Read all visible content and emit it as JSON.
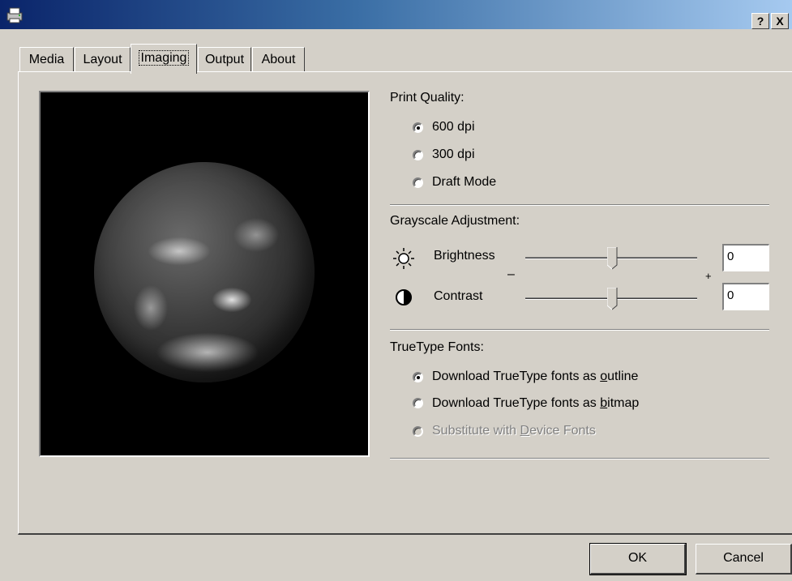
{
  "window": {
    "title": "",
    "help_button": "?",
    "close_button": "X"
  },
  "tabs": [
    {
      "label": "Media"
    },
    {
      "label": "Layout"
    },
    {
      "label": "Imaging"
    },
    {
      "label": "Output"
    },
    {
      "label": "About"
    }
  ],
  "active_tab": "Imaging",
  "print_quality": {
    "label": "Print Quality:",
    "options": [
      {
        "label": "600 dpi",
        "checked": true
      },
      {
        "label": "300 dpi",
        "checked": false
      },
      {
        "label": "Draft Mode",
        "checked": false
      }
    ]
  },
  "grayscale": {
    "label": "Grayscale Adjustment:",
    "minus": "–",
    "plus": "+",
    "brightness": {
      "label": "Brightness",
      "value": "0",
      "icon": "sun-icon"
    },
    "contrast": {
      "label": "Contrast",
      "value": "0",
      "icon": "contrast-icon"
    }
  },
  "truetype": {
    "label": "TrueType Fonts:",
    "options": [
      {
        "pre": "Download TrueType fonts as ",
        "accel": "o",
        "post": "utline",
        "checked": true,
        "disabled": false
      },
      {
        "pre": "Download TrueType fonts as ",
        "accel": "b",
        "post": "itmap",
        "checked": false,
        "disabled": false
      },
      {
        "pre": "Substitute with ",
        "accel": "D",
        "post": "evice Fonts",
        "checked": false,
        "disabled": true
      }
    ]
  },
  "buttons": {
    "ok": "OK",
    "cancel": "Cancel"
  }
}
